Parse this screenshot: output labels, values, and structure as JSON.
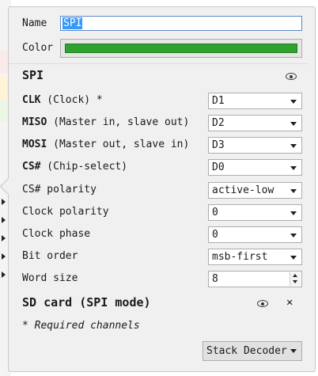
{
  "form": {
    "name_label": "Name",
    "name_value": "SPI",
    "color_label": "Color",
    "color_value": "#2ea12e"
  },
  "decoder": {
    "title": "SPI",
    "rows": [
      {
        "bold": "CLK",
        "label": " (Clock) *",
        "value": "D1"
      },
      {
        "bold": "MISO",
        "label": " (Master in, slave out)",
        "value": "D2"
      },
      {
        "bold": "MOSI",
        "label": " (Master out, slave in)",
        "value": "D3"
      },
      {
        "bold": "CS#",
        "label": " (Chip-select)",
        "value": "D0"
      },
      {
        "bold": "",
        "label": "CS# polarity",
        "value": "active-low"
      },
      {
        "bold": "",
        "label": "Clock polarity",
        "value": "0"
      },
      {
        "bold": "",
        "label": "Clock phase",
        "value": "0"
      },
      {
        "bold": "",
        "label": "Bit order",
        "value": "msb-first"
      },
      {
        "bold": "",
        "label": "Word size",
        "value": "8"
      }
    ]
  },
  "stacked": {
    "title": "SD card (SPI mode)",
    "close_glyph": "✕"
  },
  "note": "* Required channels",
  "stack_button_label": "Stack Decoder",
  "icons": {
    "visibility": "eye-icon",
    "close": "close-icon",
    "dropdown": "chevron-down-icon"
  }
}
